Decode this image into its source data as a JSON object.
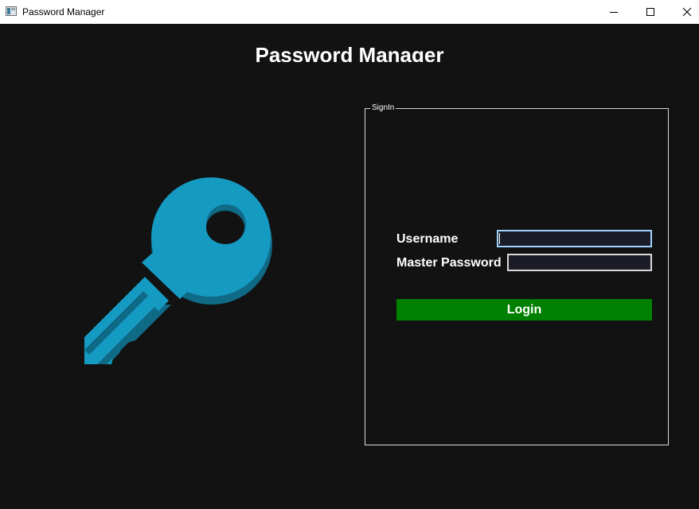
{
  "window": {
    "title": "Password Manager",
    "controls": {
      "minimize_icon": "minimize-icon",
      "maximize_icon": "maximize-icon",
      "close_icon": "close-icon"
    }
  },
  "header": {
    "title": "Password Manager"
  },
  "illustration": {
    "icon": "key-icon",
    "color": "#159ac2",
    "shadow_color": "#0f6a86"
  },
  "signin": {
    "legend": "SignIn",
    "username_label": "Username",
    "username_value": "",
    "password_label": "Master Password",
    "password_value": "",
    "login_label": "Login"
  },
  "colors": {
    "background": "#121212",
    "login_button": "#008000",
    "input_background": "#1c1b28",
    "focus_border": "#9fd4ff"
  }
}
